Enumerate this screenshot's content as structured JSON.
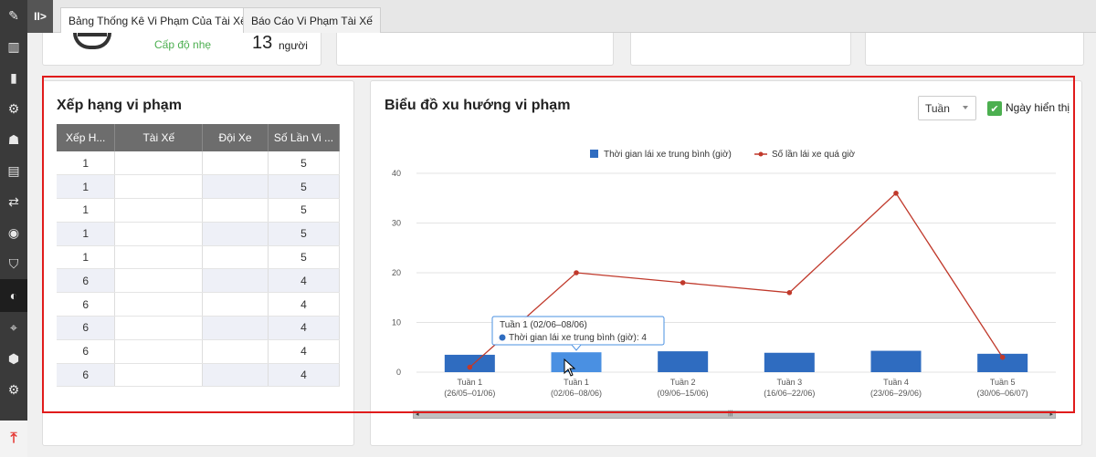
{
  "tabs": [
    {
      "label": "Bảng Thống Kê Vi Phạm Của Tài Xế"
    },
    {
      "label": "Báo Cáo Vi Phạm Tài Xế"
    }
  ],
  "summary": {
    "level_text": "Cấp độ nhẹ",
    "count": "13",
    "count_unit": "người"
  },
  "ranking": {
    "title": "Xếp hạng vi phạm",
    "columns": [
      "Xếp H...",
      "Tài Xế",
      "Đội Xe",
      "Số Lần Vi ..."
    ],
    "rows": [
      {
        "rank": "1",
        "driver": "",
        "team": "",
        "count": "5"
      },
      {
        "rank": "1",
        "driver": "",
        "team": "",
        "count": "5"
      },
      {
        "rank": "1",
        "driver": "",
        "team": "",
        "count": "5"
      },
      {
        "rank": "1",
        "driver": "",
        "team": "",
        "count": "5"
      },
      {
        "rank": "1",
        "driver": "",
        "team": "",
        "count": "5"
      },
      {
        "rank": "6",
        "driver": "",
        "team": "",
        "count": "4"
      },
      {
        "rank": "6",
        "driver": "",
        "team": "",
        "count": "4"
      },
      {
        "rank": "6",
        "driver": "",
        "team": "",
        "count": "4"
      },
      {
        "rank": "6",
        "driver": "",
        "team": "",
        "count": "4"
      },
      {
        "rank": "6",
        "driver": "",
        "team": "",
        "count": "4"
      }
    ]
  },
  "trend": {
    "title": "Biểu đồ xu hướng vi phạm",
    "period_select": "Tuần",
    "show_days_label": "Ngày hiển thị",
    "show_days_checked": true,
    "tooltip": {
      "title": "Tuần 1 (02/06–08/06)",
      "series": "Thời gian lái xe trung bình (giờ)",
      "value": "4"
    }
  },
  "chart_data": {
    "type": "bar",
    "categories": [
      {
        "line1": "Tuần 1",
        "line2": "(26/05–01/06)"
      },
      {
        "line1": "Tuần 1",
        "line2": "(02/06–08/06)"
      },
      {
        "line1": "Tuần 2",
        "line2": "(09/06–15/06)"
      },
      {
        "line1": "Tuần 3",
        "line2": "(16/06–22/06)"
      },
      {
        "line1": "Tuần 4",
        "line2": "(23/06–29/06)"
      },
      {
        "line1": "Tuần 5",
        "line2": "(30/06–06/07)"
      }
    ],
    "series": [
      {
        "name": "Thời gian lái xe trung bình (giờ)",
        "kind": "bar",
        "color": "#2f6cc0",
        "values": [
          3.5,
          4,
          4.2,
          3.9,
          4.3,
          3.7
        ]
      },
      {
        "name": "Số lần lái xe quá giờ",
        "kind": "line",
        "color": "#c0392b",
        "values": [
          1,
          20,
          18,
          16,
          36,
          3
        ]
      }
    ],
    "ylim": [
      0,
      40
    ],
    "yticks": [
      "0",
      "10",
      "20",
      "30",
      "40"
    ],
    "grid": true,
    "legend": "top-center",
    "highlight_color": "#4a90e2"
  },
  "sidebar_icons": [
    "road-icon",
    "chart-icon",
    "fuel-icon",
    "car-settings-icon",
    "driver-icon",
    "briefcase-icon",
    "route-icon",
    "speedometer-icon",
    "shield-icon",
    "driver-violation-icon",
    "location-icon",
    "hexagon-icon",
    "gear-icon",
    "scroll-top-icon"
  ]
}
